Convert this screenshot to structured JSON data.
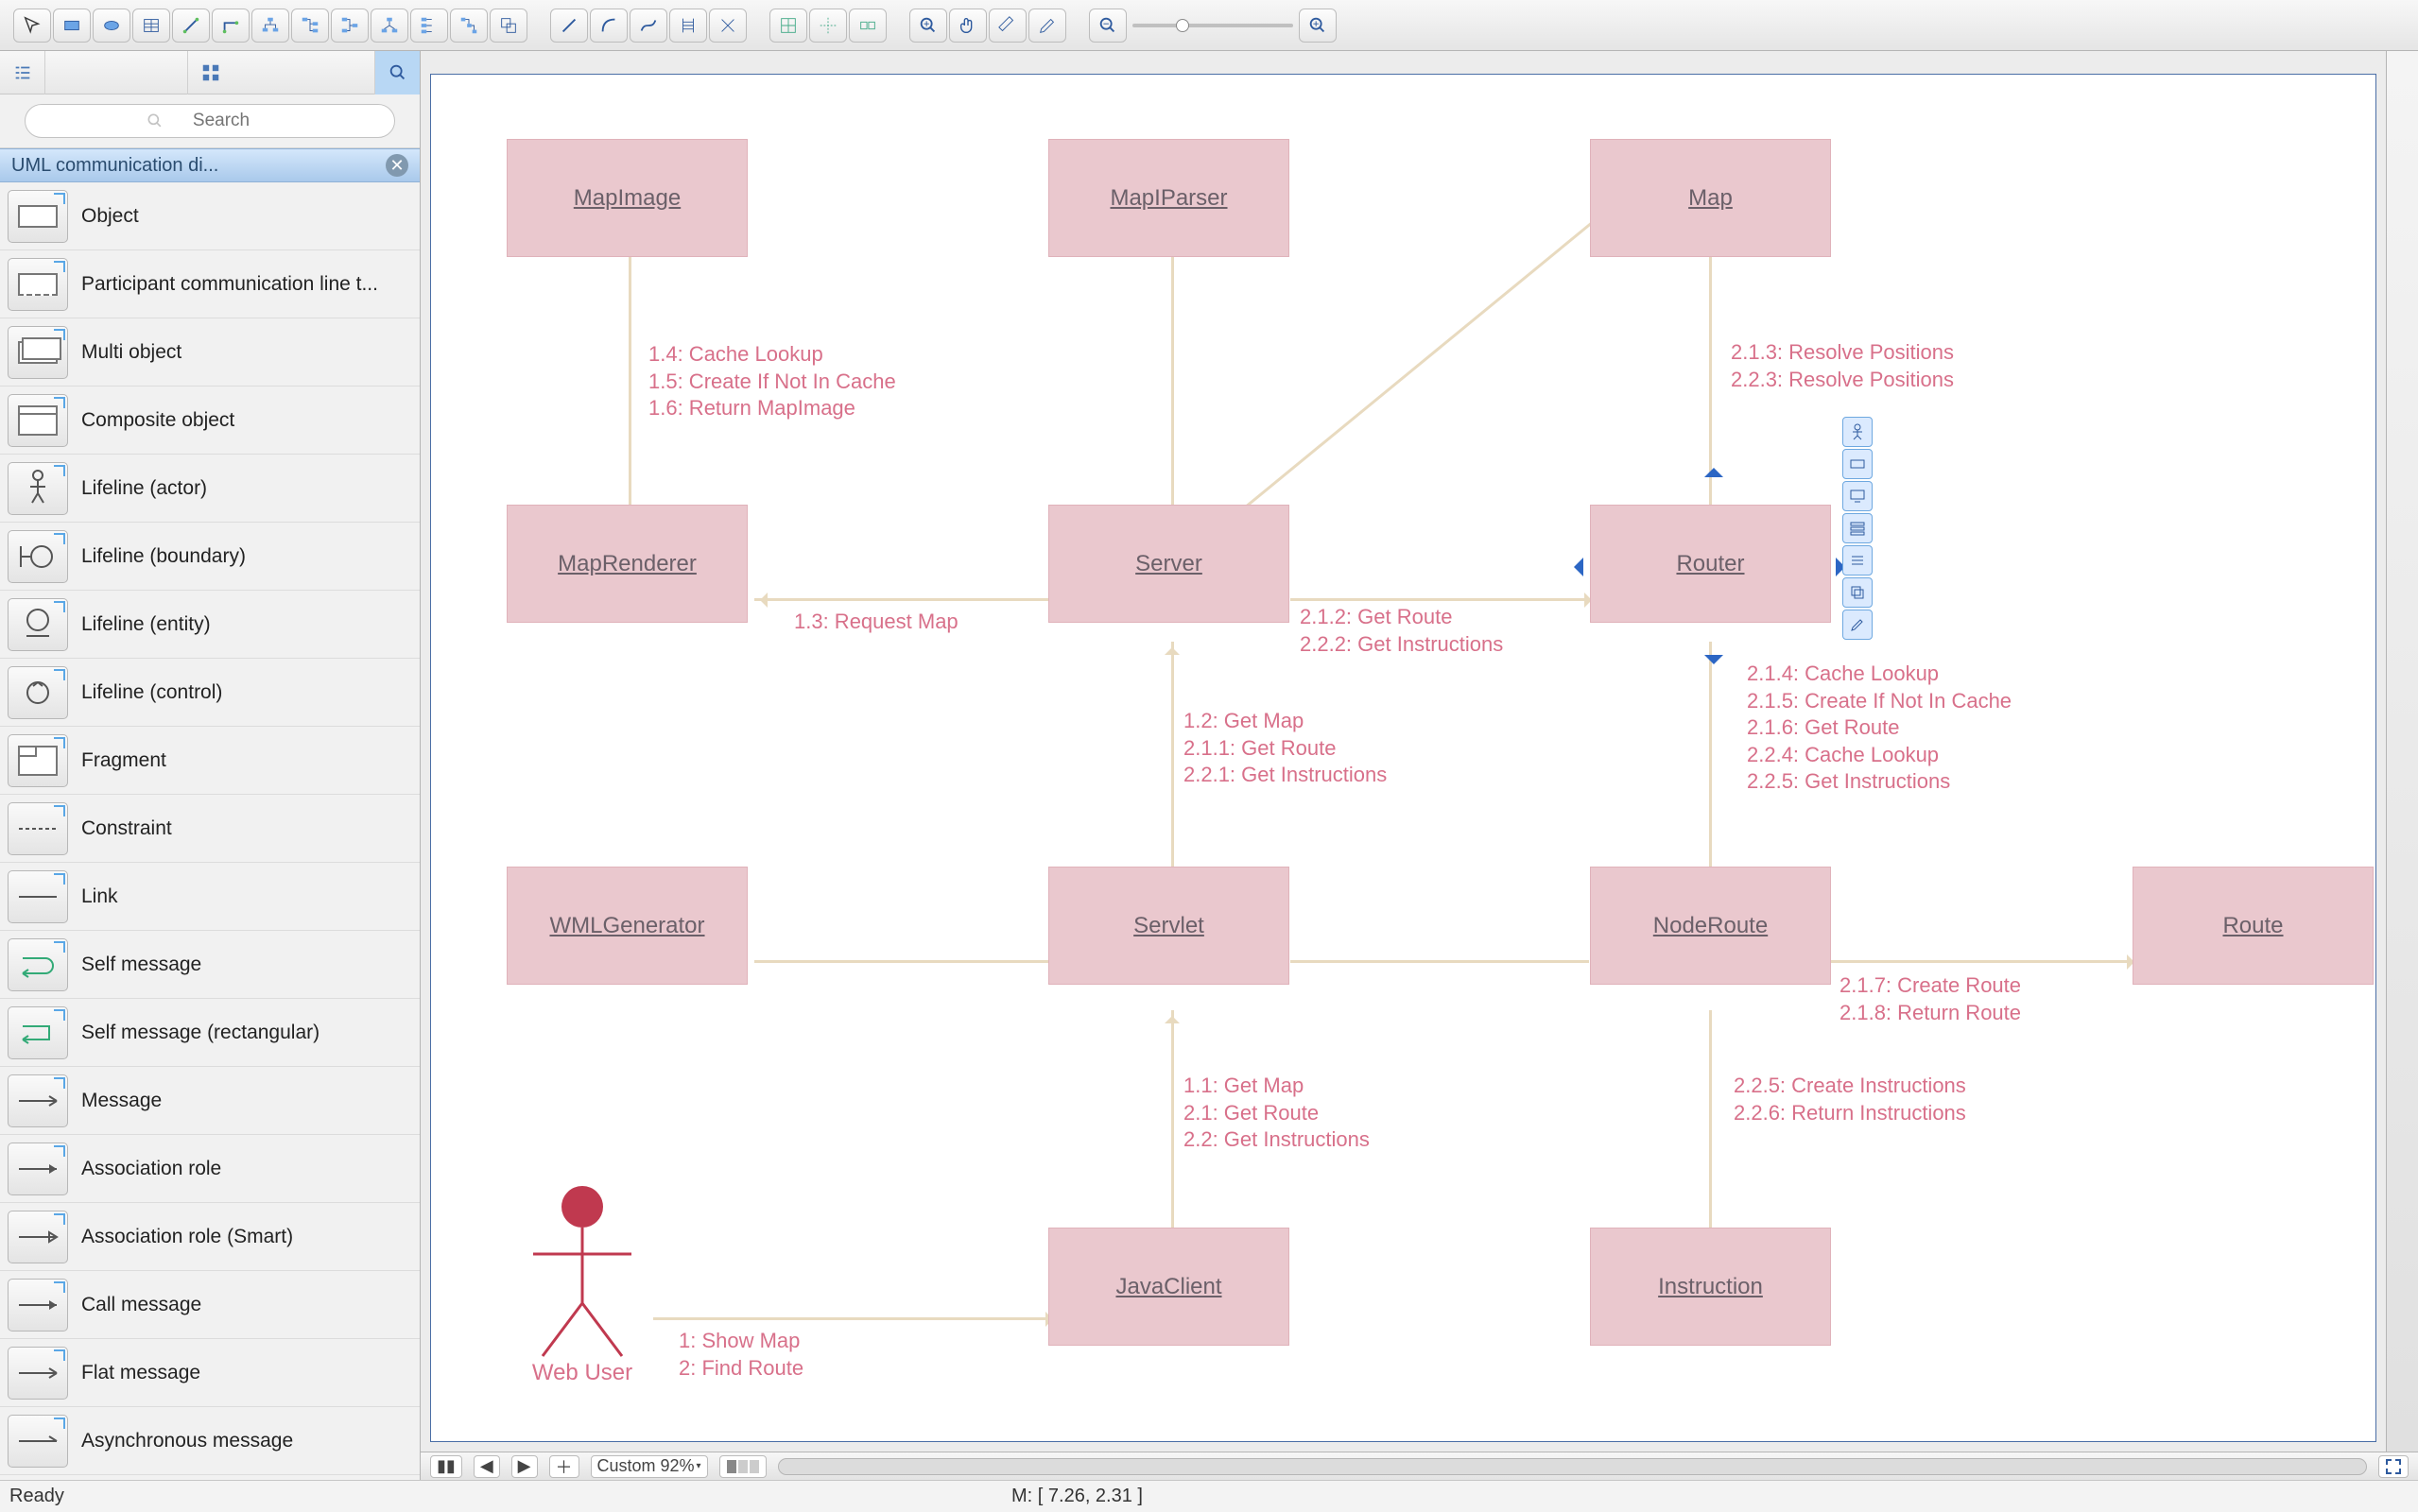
{
  "toolbar": {
    "pointer": "pointer",
    "rect": "rectangle",
    "ellipse": "ellipse",
    "table": "table",
    "flow1": "connector-straight",
    "flow2": "connector-ortho",
    "tree1": "tree-down",
    "tree2": "tree-right",
    "tree3": "tree-left",
    "tree4": "tree-mixed",
    "tree5": "tree-chain",
    "tree6": "tree-chain2",
    "seg1": "segment",
    "seg2": "arc",
    "seg3": "spline",
    "seg4": "ladder",
    "seg5": "cross",
    "snap1": "snap-grid",
    "snap2": "snap-guides",
    "snap3": "snap-objects",
    "zoom_in": "zoom-in",
    "hand": "pan",
    "marker": "highlight",
    "pencil": "edit",
    "zoom_out_big": "zoom-out",
    "zoom_in_big": "zoom-in"
  },
  "sidebar": {
    "search_placeholder": "Search",
    "section_title": "UML communication di...",
    "items": [
      {
        "label": "Object"
      },
      {
        "label": "Participant communication line t..."
      },
      {
        "label": "Multi object"
      },
      {
        "label": "Composite object"
      },
      {
        "label": "Lifeline (actor)"
      },
      {
        "label": "Lifeline (boundary)"
      },
      {
        "label": "Lifeline (entity)"
      },
      {
        "label": "Lifeline (control)"
      },
      {
        "label": "Fragment"
      },
      {
        "label": "Constraint"
      },
      {
        "label": "Link"
      },
      {
        "label": "Self message"
      },
      {
        "label": "Self message (rectangular)"
      },
      {
        "label": "Message"
      },
      {
        "label": "Association role"
      },
      {
        "label": "Association role (Smart)"
      },
      {
        "label": "Call message"
      },
      {
        "label": "Flat message"
      },
      {
        "label": "Asynchronous message"
      }
    ]
  },
  "diagram": {
    "nodes": {
      "mapimage": "MapImage",
      "mapiparser": "MapIParser",
      "map": "Map",
      "maprenderer": "MapRenderer",
      "server": "Server",
      "router": "Router",
      "wmlgenerator": "WMLGenerator",
      "servlet": "Servlet",
      "noderoute": "NodeRoute",
      "route": "Route",
      "javaclient": "JavaClient",
      "instruction": "Instruction"
    },
    "actor": "Web User",
    "messages": {
      "m_mapimage": "1.4: Cache Lookup\n1.5: Create If Not In Cache\n1.6: Return MapImage",
      "m_map": "2.1.3: Resolve Positions\n2.2.3: Resolve Positions",
      "m_reqmap": "1.3: Request Map",
      "m_getroute": "2.1.2: Get Route\n2.2.2: Get Instructions",
      "m_router": "2.1.4: Cache Lookup\n2.1.5: Create If Not In Cache\n2.1.6: Get Route\n2.2.4: Cache Lookup\n2.2.5: Get Instructions",
      "m_servlet": "1.2: Get Map\n2.1.1: Get Route\n2.2.1: Get Instructions",
      "m_route": "2.1.7: Create Route\n2.1.8: Return Route",
      "m_javaclient": "1.1: Get Map\n2.1: Get Route\n2.2: Get Instructions",
      "m_instruction": "2.2.5: Create Instructions\n2.2.6: Return Instructions",
      "m_actor": "1: Show Map\n2: Find Route"
    }
  },
  "bottom": {
    "zoom_label": "Custom 92%"
  },
  "status": {
    "ready": "Ready",
    "coord": "M: [ 7.26, 2.31 ]"
  }
}
